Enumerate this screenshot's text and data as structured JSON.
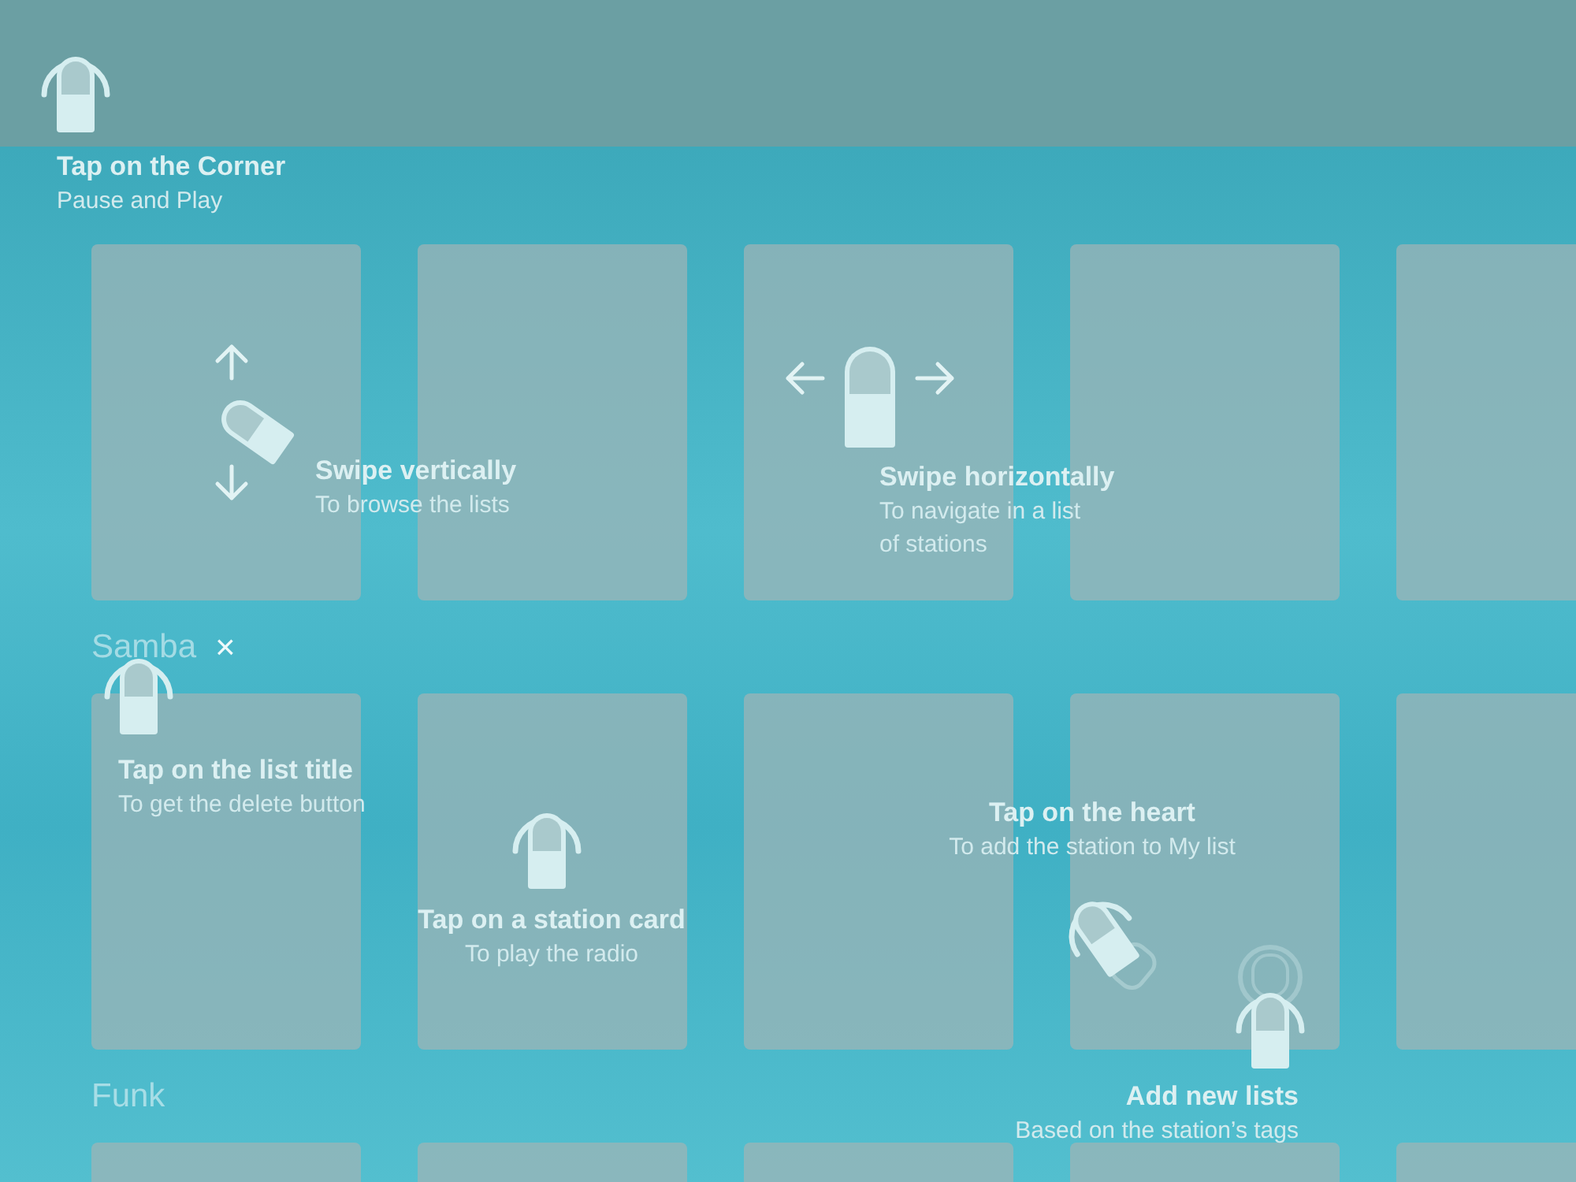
{
  "lists": [
    {
      "title": "Samba",
      "delete_button": "×"
    },
    {
      "title": "Funk"
    }
  ],
  "hints": [
    {
      "kind": "tap",
      "title": "Tap on the Corner",
      "subtitle": "Pause and Play"
    },
    {
      "kind": "swipe_vertical",
      "title": "Swipe vertically",
      "subtitle": "To browse the lists"
    },
    {
      "kind": "swipe_horizontal",
      "title": "Swipe horizontally",
      "subtitle": "To navigate in a list of stations"
    },
    {
      "kind": "tap",
      "title": "Tap on the list title",
      "subtitle": "To get the delete button"
    },
    {
      "kind": "tap",
      "title": "Tap on a station card",
      "subtitle": "To play the radio"
    },
    {
      "kind": "tap_heart",
      "title": "Tap on the heart",
      "subtitle": "To add the station to My list"
    },
    {
      "kind": "tap_double",
      "title": "Add new lists",
      "subtitle": "Based on the station’s tags"
    }
  ]
}
